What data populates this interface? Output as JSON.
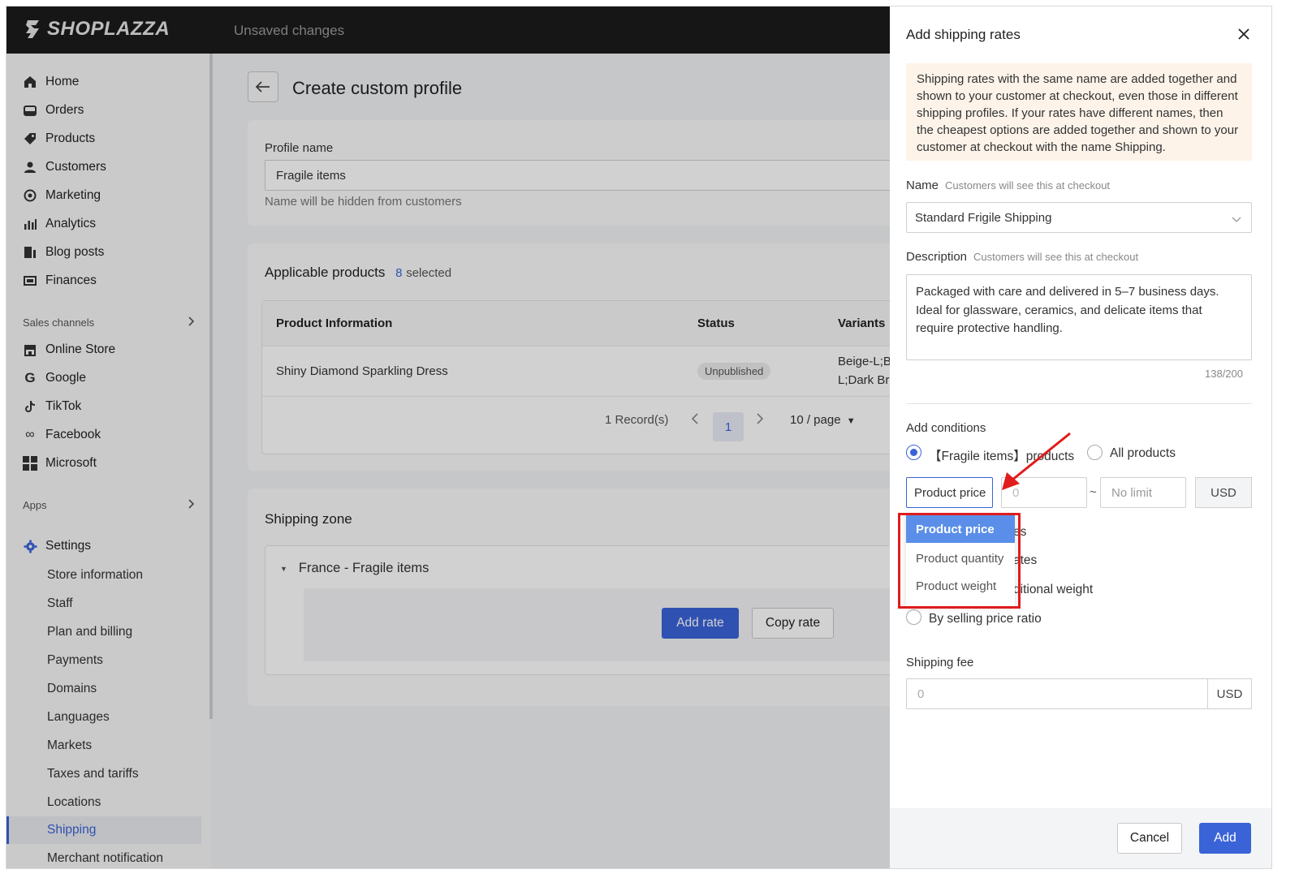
{
  "app": {
    "logo_text": "SHOPLAZZA",
    "status": "Unsaved changes"
  },
  "sidebar": {
    "items": [
      {
        "label": "Home",
        "icon": "home-icon"
      },
      {
        "label": "Orders",
        "icon": "orders-icon"
      },
      {
        "label": "Products",
        "icon": "tag-icon"
      },
      {
        "label": "Customers",
        "icon": "user-icon"
      },
      {
        "label": "Marketing",
        "icon": "marketing-icon"
      },
      {
        "label": "Analytics",
        "icon": "bar-chart-icon"
      },
      {
        "label": "Blog posts",
        "icon": "blog-icon"
      },
      {
        "label": "Finances",
        "icon": "finance-icon"
      }
    ],
    "sales_channels_label": "Sales channels",
    "channels": [
      {
        "label": "Online Store",
        "icon": "store-icon"
      },
      {
        "label": "Google",
        "icon": "google-icon"
      },
      {
        "label": "TikTok",
        "icon": "tiktok-icon"
      },
      {
        "label": "Facebook",
        "icon": "meta-icon"
      },
      {
        "label": "Microsoft",
        "icon": "microsoft-icon"
      }
    ],
    "apps_label": "Apps",
    "settings_label": "Settings",
    "settings_items": [
      "Store information",
      "Staff",
      "Plan and billing",
      "Payments",
      "Domains",
      "Languages",
      "Markets",
      "Taxes and tariffs",
      "Locations",
      "Shipping",
      "Merchant notification"
    ]
  },
  "page": {
    "title": "Create custom profile",
    "profile_name_label": "Profile name",
    "profile_name_value": "Fragile items",
    "profile_name_hint": "Name will be hidden from customers",
    "applicable_products_label": "Applicable products",
    "selected_count": "8",
    "selected_suffix": "selected",
    "table": {
      "headers": [
        "Product Information",
        "Status",
        "Variants"
      ],
      "rows": [
        {
          "product": "Shiny Diamond Sparkling Dress",
          "status": "Unpublished",
          "variants_line1": "Beige-L;Be",
          "variants_line2": "L;Dark Bro"
        }
      ]
    },
    "records": "1 Record(s)",
    "current_page": "1",
    "per_page": "10 / page",
    "shipping_zone_label": "Shipping zone",
    "zone_name": "France - Fragile items",
    "add_rate": "Add rate",
    "copy_rate": "Copy rate"
  },
  "drawer": {
    "title": "Add shipping rates",
    "notice": "Shipping rates with the same name are added together and shown to your customer at checkout, even those in different shipping profiles. If your rates have different names, then the cheapest options are added together and shown to your customer at checkout with the name Shipping.",
    "name_label": "Name",
    "name_hint": "Customers will see this at checkout",
    "name_value": "Standard Frigile Shipping",
    "desc_label": "Description",
    "desc_hint": "Customers will see this at checkout",
    "desc_value": "Packaged with care and delivered in 5–7 business days. Ideal for glassware, ceramics, and delicate items that require protective handling.",
    "desc_counter": "138/200",
    "conditions_label": "Add conditions",
    "cond_option1": "【Fragile items】products",
    "cond_option2": "All products",
    "condition_type": "Product price",
    "min_placeholder": "0",
    "range_sep": "~",
    "max_placeholder": "No limit",
    "currency": "USD",
    "dropdown_options": [
      "Product price",
      "Product quantity",
      "Product weight"
    ],
    "hidden_options_tail": [
      "es",
      "ates",
      "ditional weight"
    ],
    "ratio_option": "By selling price ratio",
    "shipping_fee_label": "Shipping fee",
    "shipping_fee_placeholder": "0",
    "fee_currency": "USD",
    "cancel": "Cancel",
    "add": "Add"
  },
  "colors": {
    "accent": "#3a63d8",
    "annotation": "#e01c1c",
    "notice_bg": "#fdf3e9"
  }
}
